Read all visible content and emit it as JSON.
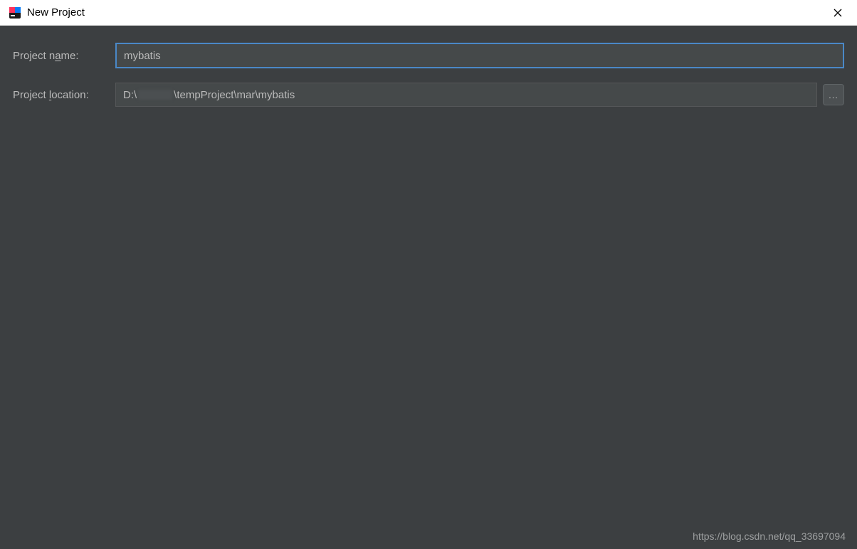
{
  "window": {
    "title": "New Project"
  },
  "form": {
    "projectName": {
      "label_pre": "Project n",
      "label_mn": "a",
      "label_post": "me:",
      "value": "mybatis"
    },
    "projectLocation": {
      "label_pre": "Project ",
      "label_mn": "l",
      "label_post": "ocation:",
      "value_prefix": "D:\\",
      "value_suffix": "\\tempProject\\mar\\mybatis",
      "browse_label": "..."
    }
  },
  "watermark": "https://blog.csdn.net/qq_33697094"
}
